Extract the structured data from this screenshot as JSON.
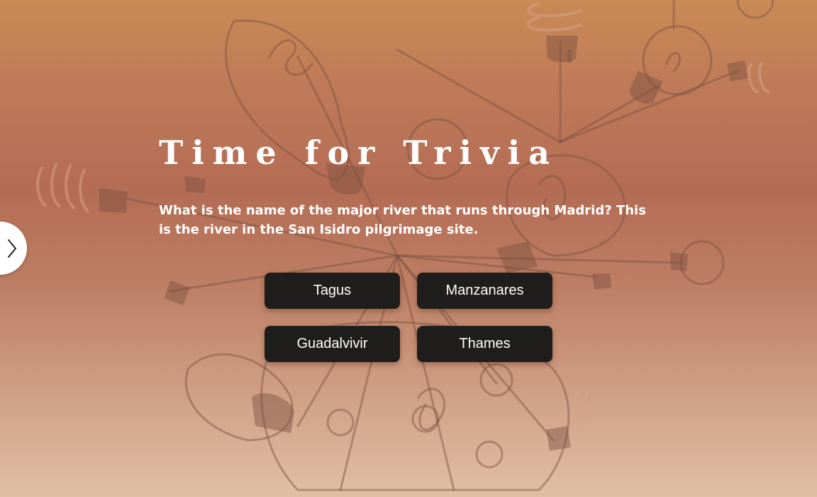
{
  "slide": {
    "title": "Time for Trivia",
    "question": "What is the name of the major river that runs through Madrid? This is the river in the San Isidro pilgrimage site."
  },
  "answers": [
    {
      "label": "Tagus"
    },
    {
      "label": "Manzanares"
    },
    {
      "label": "Guadalvivir"
    },
    {
      "label": "Thames"
    }
  ],
  "navigation": {
    "next_icon": "chevron-right-icon"
  },
  "background": {
    "illustration": "lightbulb-doodle",
    "colors": {
      "top": "#c98a55",
      "middle": "#b46c54",
      "bottom": "#e0bfa6",
      "button": "#1f1e1c",
      "text": "#ffffff"
    }
  }
}
